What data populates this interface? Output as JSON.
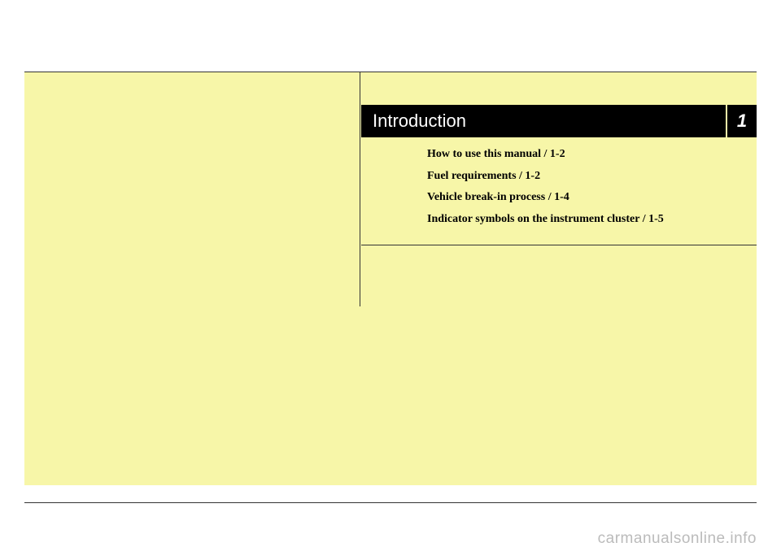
{
  "chapter": {
    "title": "Introduction",
    "number": "1"
  },
  "toc": {
    "items": [
      "How to use this manual / 1-2",
      "Fuel requirements / 1-2",
      "Vehicle break-in process / 1-4",
      "Indicator symbols on the instrument cluster / 1-5"
    ]
  },
  "watermark": "carmanualsonline.info"
}
